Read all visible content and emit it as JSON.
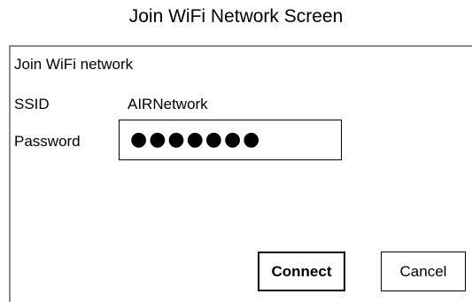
{
  "caption": "Join WiFi Network Screen",
  "dialog": {
    "title": "Join WiFi network",
    "ssid_label": "SSID",
    "ssid_value": "AIRNetwork",
    "password_label": "Password",
    "password_mask": "●●●●●●●",
    "connect_label": "Connect",
    "cancel_label": "Cancel"
  }
}
